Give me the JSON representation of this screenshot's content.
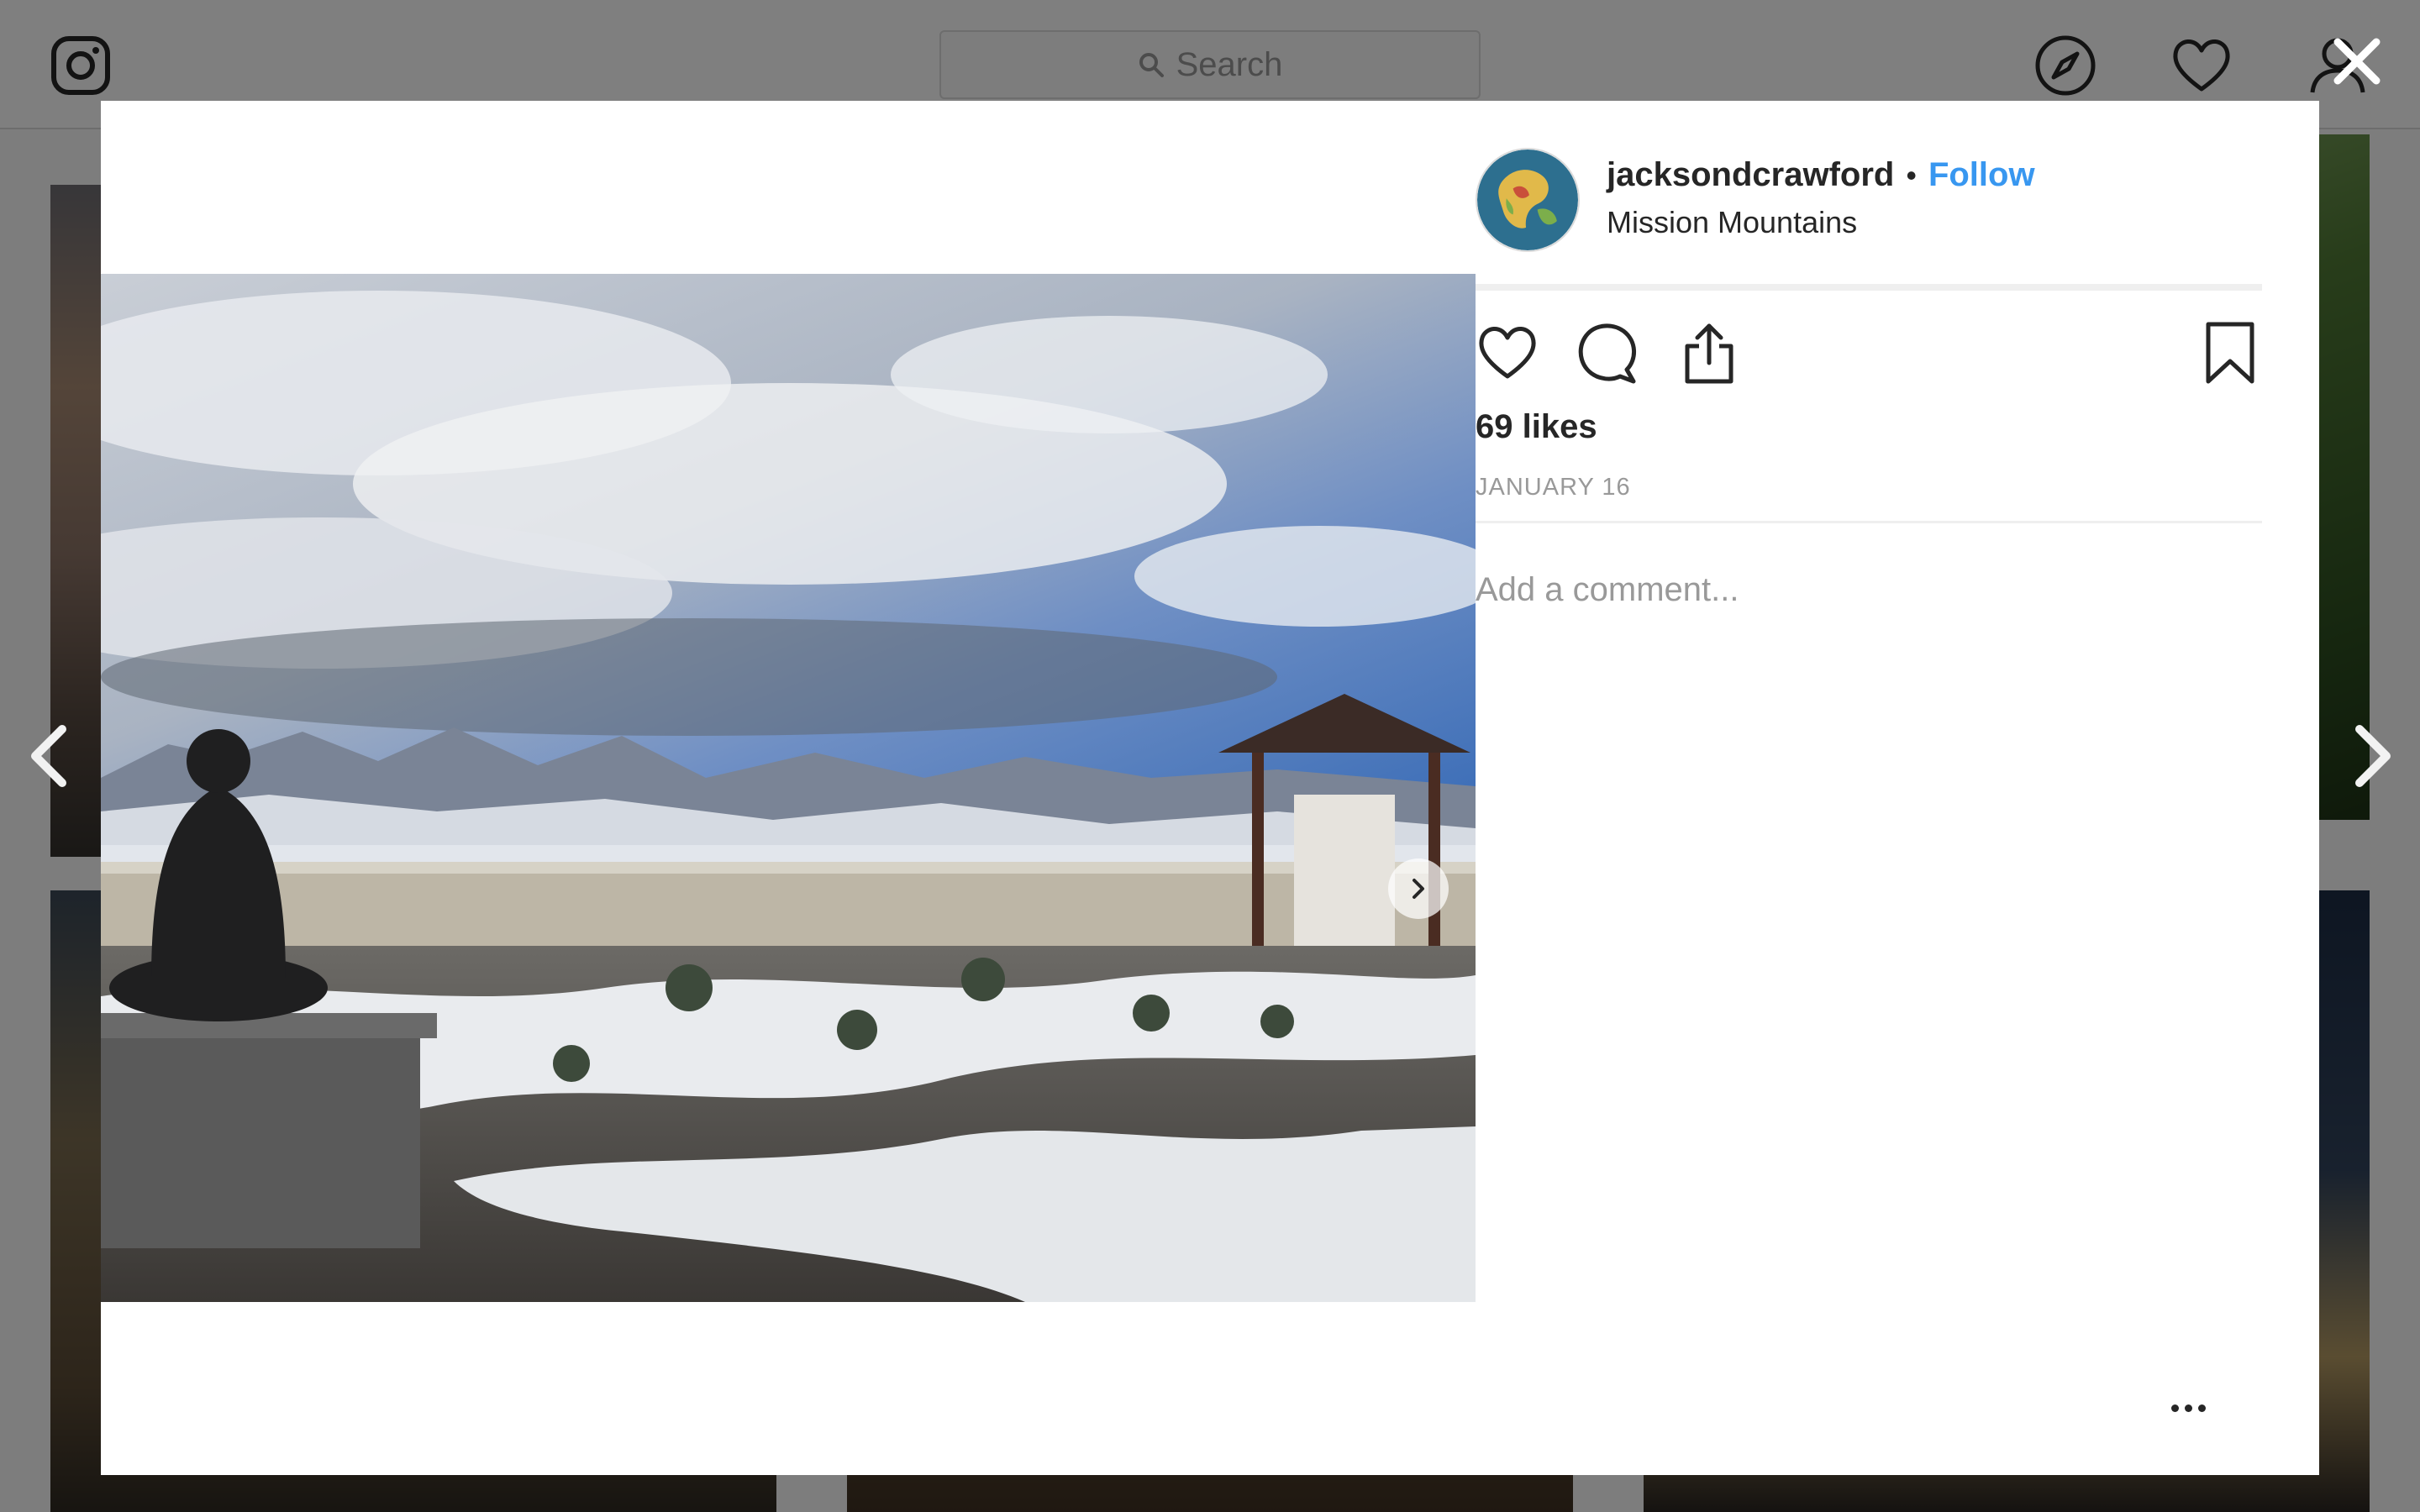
{
  "topbar": {
    "logo_icon": "instagram-logo-icon",
    "search_placeholder": "Search",
    "icons": [
      "compass-icon",
      "heart-icon",
      "profile-icon"
    ]
  },
  "overlay": {
    "close_icon": "close-icon",
    "prev_icon": "chevron-left-icon",
    "next_icon": "chevron-right-icon"
  },
  "post": {
    "username": "jacksondcrawford",
    "separator": "•",
    "follow_label": "Follow",
    "location": "Mission Mountains",
    "likes": "69 likes",
    "date": "JANUARY 16",
    "comment_placeholder": "Add a comment...",
    "actions": [
      "heart-icon",
      "comment-icon",
      "share-icon",
      "bookmark-icon"
    ],
    "more_icon": "more-options-icon",
    "photo_next_icon": "chevron-right-icon"
  },
  "colors": {
    "follow": "#3897f0",
    "text": "#262626",
    "muted": "#999999",
    "overlay": "rgba(0,0,0,0.5)"
  }
}
